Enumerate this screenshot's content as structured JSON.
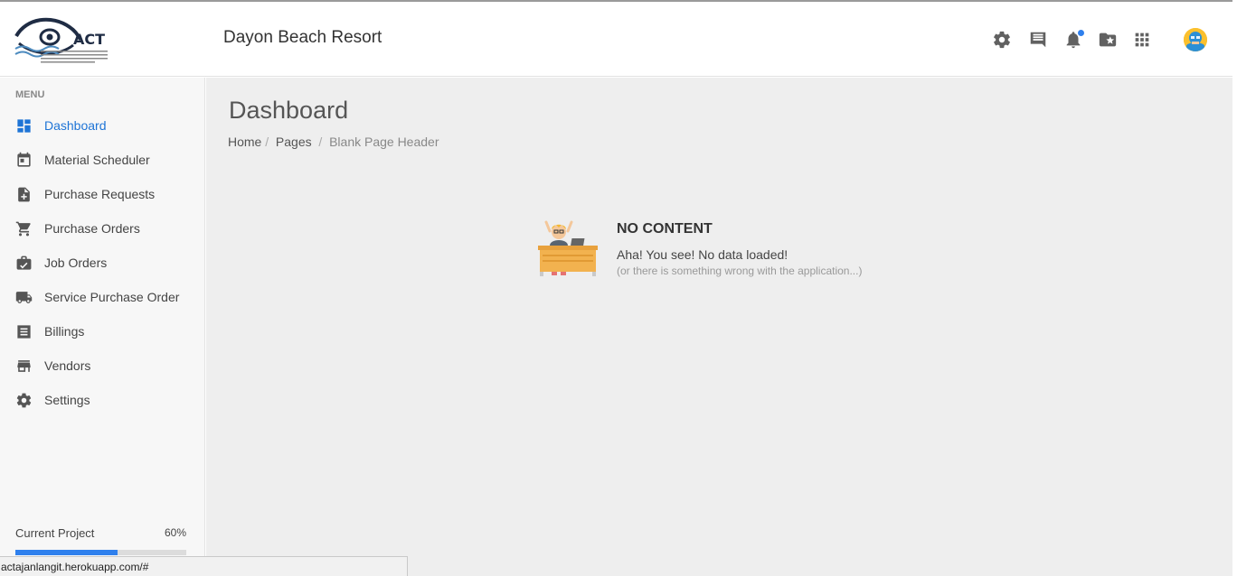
{
  "header": {
    "logo_text": "ACT",
    "logo_subtext": "AC TAJANLANGIT CONSTRUCTIVE BUILDERS AND DEVELOPMENT CORP.",
    "project_title": "Dayon Beach Resort",
    "icons": [
      "gear-icon",
      "chat-icon",
      "bell-icon",
      "folder-star-icon",
      "apps-grid-icon"
    ],
    "notification_dot_color": "#2f80ed"
  },
  "sidebar": {
    "menu_header": "MENU",
    "items": [
      {
        "label": "Dashboard",
        "icon": "dashboard-icon",
        "active": true
      },
      {
        "label": "Material Scheduler",
        "icon": "calendar-icon",
        "active": false
      },
      {
        "label": "Purchase Requests",
        "icon": "file-add-icon",
        "active": false
      },
      {
        "label": "Purchase Orders",
        "icon": "cart-icon",
        "active": false
      },
      {
        "label": "Job Orders",
        "icon": "work-bag-icon",
        "active": false
      },
      {
        "label": "Service Purchase Order",
        "icon": "truck-icon",
        "active": false
      },
      {
        "label": "Billings",
        "icon": "receipt-icon",
        "active": false
      },
      {
        "label": "Vendors",
        "icon": "store-icon",
        "active": false
      },
      {
        "label": "Settings",
        "icon": "settings-icon",
        "active": false
      }
    ],
    "progress": {
      "label": "Current Project",
      "value_text": "60%",
      "fraction": 0.6
    }
  },
  "main": {
    "title": "Dashboard",
    "breadcrumb": [
      {
        "label": "Home",
        "sep": "/"
      },
      {
        "label": "Pages",
        "sep": "/"
      },
      {
        "label": "Blank Page Header"
      }
    ],
    "empty_state": {
      "title": "NO CONTENT",
      "message": "Aha! You see! No data loaded!",
      "submessage": "(or there is something wrong with the application...)"
    }
  },
  "status_bar": {
    "url": "actajanlangit.herokuapp.com/#"
  },
  "colors": {
    "accent": "#1e74d6",
    "progress": "#2f80ed",
    "content_bg": "#eeeeee",
    "sidebar_bg": "#f7f7f7"
  }
}
